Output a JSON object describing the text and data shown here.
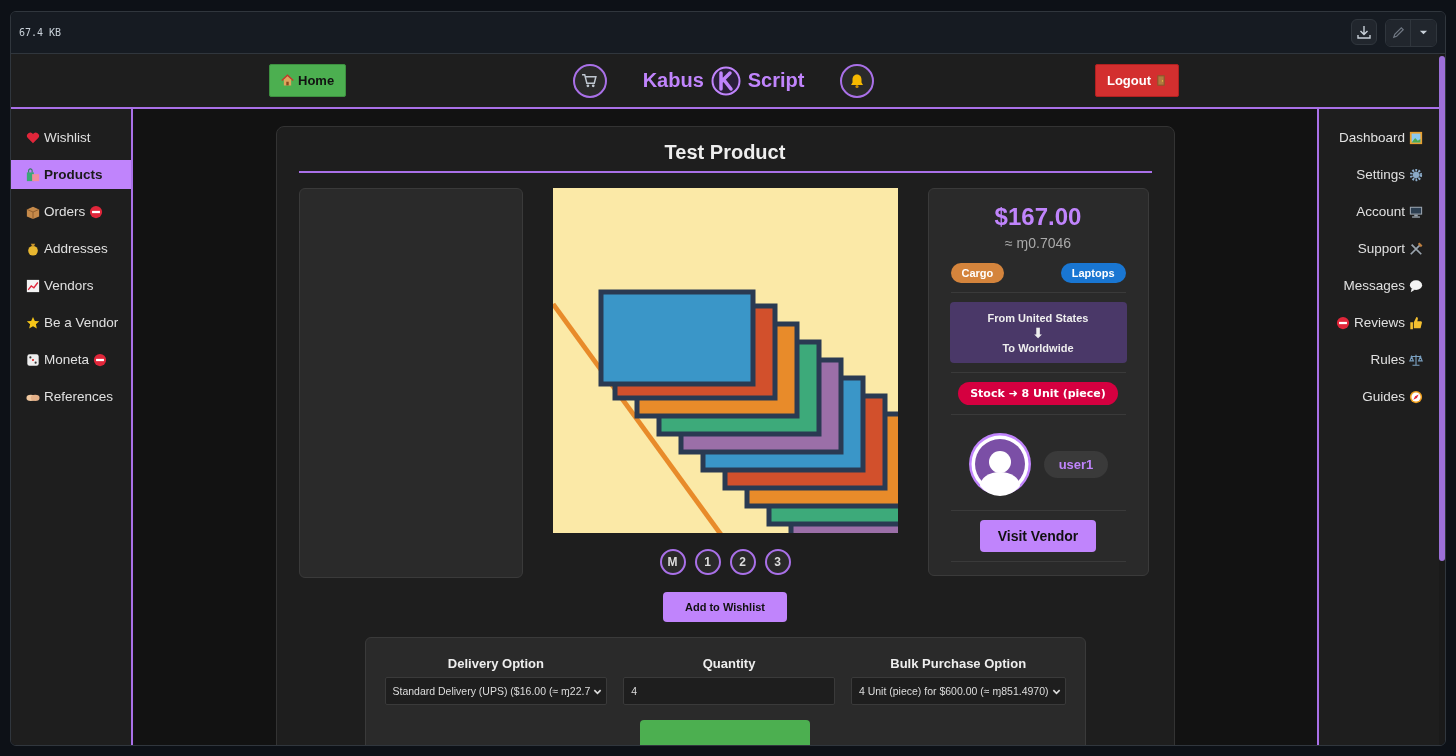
{
  "viewer": {
    "file_size": "67.4 KB"
  },
  "nav": {
    "home": "Home",
    "logo_left": "Kabus",
    "logo_right": "Script",
    "logout": "Logout"
  },
  "left_menu": [
    {
      "label": "Wishlist",
      "selected": false,
      "blocked": false
    },
    {
      "label": "Products",
      "selected": true,
      "blocked": false
    },
    {
      "label": "Orders",
      "selected": false,
      "blocked": true
    },
    {
      "label": "Addresses",
      "selected": false,
      "blocked": false
    },
    {
      "label": "Vendors",
      "selected": false,
      "blocked": false
    },
    {
      "label": "Be a Vendor",
      "selected": false,
      "blocked": false
    },
    {
      "label": "Moneta",
      "selected": false,
      "blocked": true
    },
    {
      "label": "References",
      "selected": false,
      "blocked": false
    }
  ],
  "right_menu": [
    {
      "label": "Dashboard",
      "selected": false,
      "blocked": false
    },
    {
      "label": "Settings",
      "selected": false,
      "blocked": false
    },
    {
      "label": "Account",
      "selected": false,
      "blocked": false
    },
    {
      "label": "Support",
      "selected": false,
      "blocked": false
    },
    {
      "label": "Messages",
      "selected": false,
      "blocked": false
    },
    {
      "label": "Reviews",
      "selected": false,
      "blocked": true
    },
    {
      "label": "Rules",
      "selected": false,
      "blocked": false
    },
    {
      "label": "Guides",
      "selected": false,
      "blocked": false
    }
  ],
  "product": {
    "title": "Test Product",
    "image_pages": [
      "M",
      "1",
      "2",
      "3"
    ],
    "price": "$167.00",
    "price_crypto": "≈ ɱ0.7046",
    "tags": [
      {
        "label": "Cargo",
        "color": "#d4843c"
      },
      {
        "label": "Laptops",
        "color": "#1976d2"
      }
    ],
    "ship_from": "From United States",
    "ship_arrow": "⬇",
    "ship_to": "To Worldwide",
    "stock": "Stock ➜ 8 Unit (piece)",
    "vendor": "user1",
    "visit_button": "Visit Vendor"
  },
  "wishlist_button": "Add to Wishlist",
  "order": {
    "fields": [
      {
        "kind": "select",
        "label": "Delivery Option",
        "value": "Standard Delivery (UPS) ($16.00 (≈ ɱ22.7"
      },
      {
        "kind": "input",
        "label": "Quantity",
        "value": "4"
      },
      {
        "kind": "select",
        "label": "Bulk Purchase Option",
        "value": "4 Unit (piece) for $600.00 (≈ ɱ851.4970)"
      }
    ]
  }
}
